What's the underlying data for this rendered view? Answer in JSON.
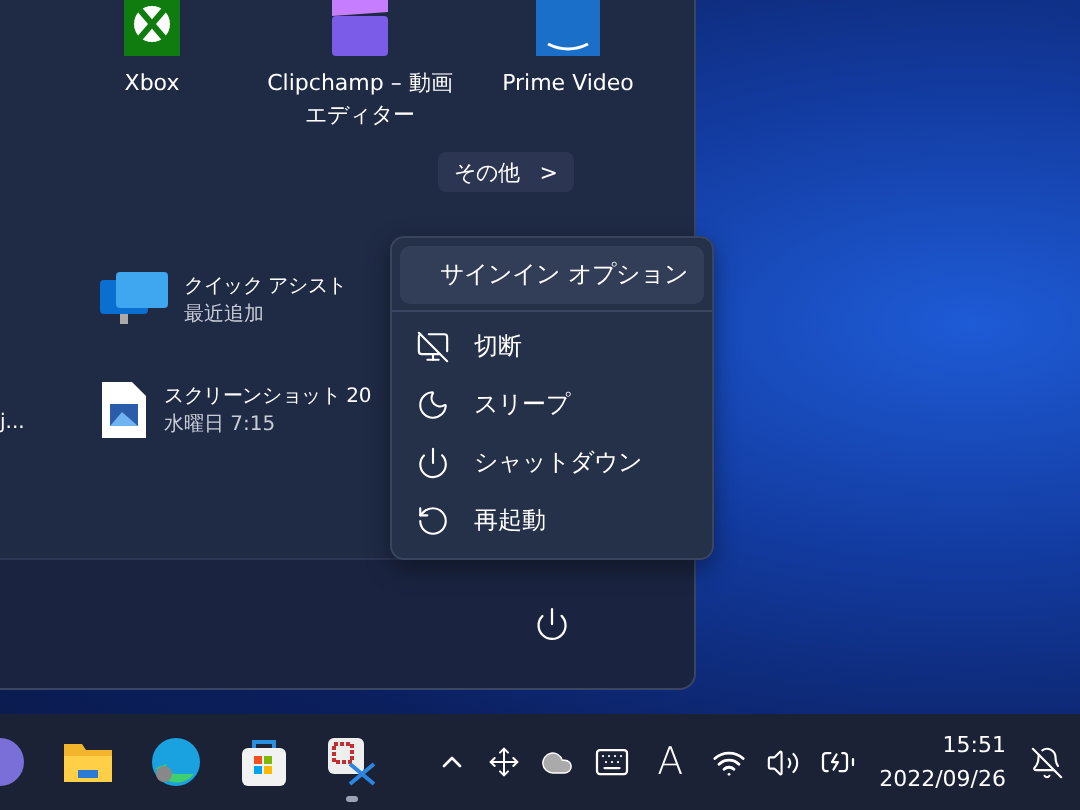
{
  "pinned_apps": [
    {
      "label": "Xbox",
      "kind": "xbox"
    },
    {
      "label": "Clipchamp – 動画エディター",
      "kind": "clipchamp"
    },
    {
      "label": "Prime Video",
      "kind": "prime"
    }
  ],
  "more_button": {
    "label": "その他",
    "arrow": ">"
  },
  "recommended": [
    {
      "title": "クイック アシスト",
      "subtitle": "最近追加",
      "kind": "monitor"
    },
    {
      "title": "スクリーンショット 20",
      "subtitle": "水曜日 7:15",
      "kind": "image"
    }
  ],
  "left_column_text": "j...",
  "power_menu": [
    {
      "label": "サインイン オプション",
      "kind": "settings",
      "selected": true
    },
    {
      "label": "切断",
      "kind": "disconnect",
      "selected": false
    },
    {
      "label": "スリープ",
      "kind": "sleep",
      "selected": false
    },
    {
      "label": "シャットダウン",
      "kind": "shutdown",
      "selected": false
    },
    {
      "label": "再起動",
      "kind": "restart",
      "selected": false
    }
  ],
  "taskbar": {
    "apps": [
      {
        "kind": "app",
        "running": false
      },
      {
        "kind": "folder",
        "running": false
      },
      {
        "kind": "browser",
        "running": false
      },
      {
        "kind": "store",
        "running": false
      },
      {
        "kind": "snip",
        "running": true
      }
    ],
    "ime_indicator": "A",
    "time": "15:51",
    "date": "2022/09/26"
  }
}
